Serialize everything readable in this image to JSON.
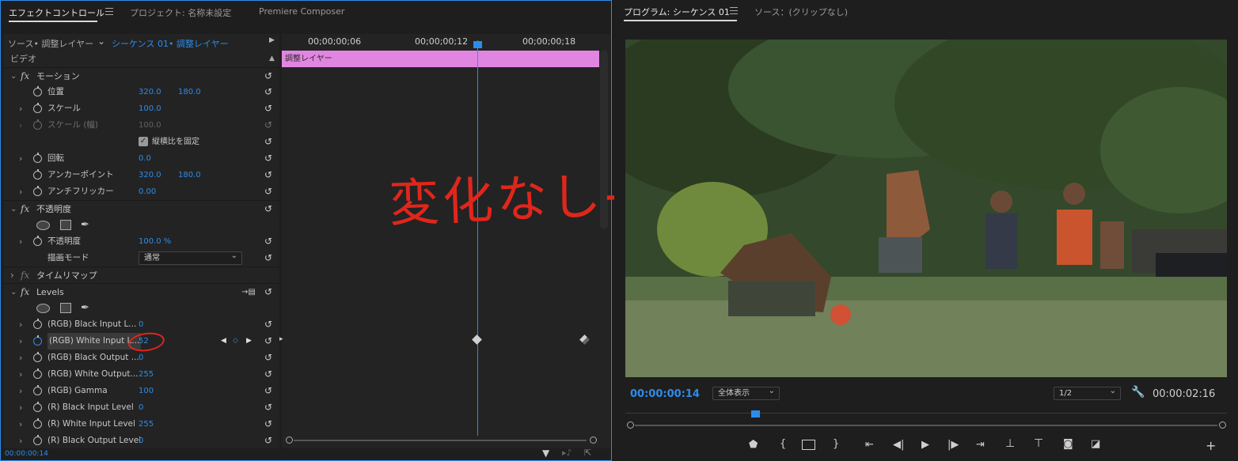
{
  "left_panel": {
    "tabs": [
      {
        "label": "エフェクトコントロール",
        "active": true
      },
      {
        "label": "プロジェクト: 名称未設定",
        "active": false
      },
      {
        "label": "Premiere Composer",
        "active": false
      }
    ],
    "source_label": "ソース• 調整レイヤー",
    "sequence_label": "シーケンス 01• 調整レイヤー",
    "section_label": "ビデオ",
    "clip_label": "調整レイヤー",
    "timecodes": [
      "00;00;00;06",
      "00;00;00;12",
      "00;00;00;18"
    ],
    "current_time": "00:00:00:14",
    "annotation_text": "変化なし→",
    "effects": {
      "motion": {
        "title": "モーション",
        "position": {
          "label": "位置",
          "x": "320.0",
          "y": "180.0"
        },
        "scale": {
          "label": "スケール",
          "value": "100.0"
        },
        "scale_width": {
          "label": "スケール (幅)",
          "value": "100.0"
        },
        "uniform_scale": {
          "label": "縦横比を固定",
          "checked": true
        },
        "rotation": {
          "label": "回転",
          "value": "0.0"
        },
        "anchor": {
          "label": "アンカーポイント",
          "x": "320.0",
          "y": "180.0"
        },
        "antiflicker": {
          "label": "アンチフリッカー",
          "value": "0.00"
        }
      },
      "opacity": {
        "title": "不透明度",
        "opacity": {
          "label": "不透明度",
          "value": "100.0 %"
        },
        "blend_mode": {
          "label": "描画モード",
          "value": "通常"
        }
      },
      "time_remap": {
        "title": "タイムリマップ"
      },
      "levels": {
        "title": "Levels",
        "params": [
          {
            "label": "(RGB) Black Input L...",
            "value": "0"
          },
          {
            "label": "(RGB) White Input L...",
            "value": "52"
          },
          {
            "label": "(RGB) Black Output ...",
            "value": "0"
          },
          {
            "label": "(RGB) White Output...",
            "value": "255"
          },
          {
            "label": "(RGB) Gamma",
            "value": "100"
          },
          {
            "label": "(R) Black Input Level",
            "value": "0"
          },
          {
            "label": "(R) White Input Level",
            "value": "255"
          },
          {
            "label": "(R) Black Output Level",
            "value": "0"
          }
        ]
      }
    }
  },
  "right_panel": {
    "tabs": [
      {
        "label": "プログラム: シーケンス 01",
        "active": true
      },
      {
        "label": "ソース：(クリップなし)",
        "active": false
      }
    ],
    "playhead_time": "00:00:00:14",
    "zoom_label": "全体表示",
    "resolution": "1/2",
    "duration": "00:00:02:16"
  },
  "colors": {
    "accent": "#2d8ceb",
    "clip": "#e186e0",
    "annotation": "#e0261c"
  }
}
